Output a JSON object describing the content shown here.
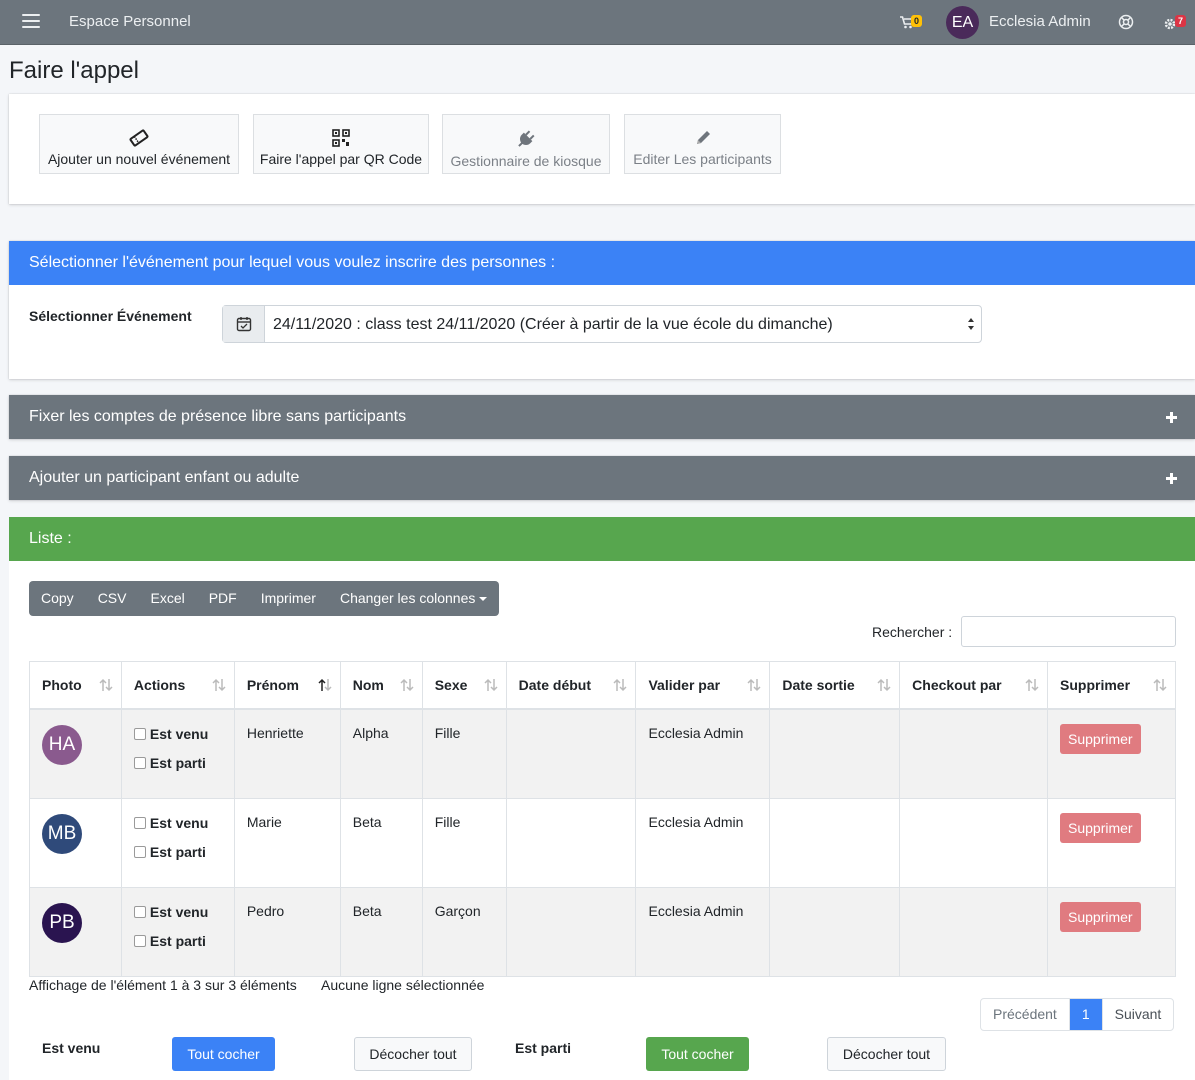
{
  "navbar": {
    "title": "Espace Personnel",
    "cart_count": "0",
    "avatar_initials": "EA",
    "user_name": "Ecclesia Admin",
    "notification_count": "7"
  },
  "page_title": "Faire l'appel",
  "toolbar": {
    "add_event": "Ajouter un nouvel événement",
    "qr_code": "Faire l'appel par QR Code",
    "kiosk": "Gestionnaire de kiosque",
    "edit_participants": "Editer Les participants"
  },
  "select_event": {
    "header": "Sélectionner l'événement pour lequel vous voulez inscrire des personnes :",
    "label": "Sélectionner Événement",
    "value": "24/11/2020 : class test 24/11/2020 (Créer à partir de la vue école du dimanche)"
  },
  "free_counts": {
    "header": "Fixer les comptes de présence libre sans participants"
  },
  "add_participant": {
    "header": "Ajouter un participant enfant ou adulte"
  },
  "list": {
    "header": "Liste :",
    "buttons": [
      "Copy",
      "CSV",
      "Excel",
      "PDF",
      "Imprimer",
      "Changer les colonnes"
    ],
    "search_label": "Rechercher :",
    "search_value": "",
    "columns": [
      "Photo",
      "Actions",
      "Prénom",
      "Nom",
      "Sexe",
      "Date début",
      "Valider par",
      "Date sortie",
      "Checkout par",
      "Supprimer"
    ],
    "check_in_label": "Est venu",
    "check_out_label": "Est parti",
    "delete_label": "Supprimer",
    "rows": [
      {
        "initials": "HA",
        "color": "#8a5a8e",
        "prenom": "Henriette",
        "nom": "Alpha",
        "sexe": "Fille",
        "date_debut": "",
        "valider_par": "Ecclesia Admin",
        "date_sortie": "",
        "checkout_par": ""
      },
      {
        "initials": "MB",
        "color": "#2f4a7a",
        "prenom": "Marie",
        "nom": "Beta",
        "sexe": "Fille",
        "date_debut": "",
        "valider_par": "Ecclesia Admin",
        "date_sortie": "",
        "checkout_par": ""
      },
      {
        "initials": "PB",
        "color": "#2a1450",
        "prenom": "Pedro",
        "nom": "Beta",
        "sexe": "Garçon",
        "date_debut": "",
        "valider_par": "Ecclesia Admin",
        "date_sortie": "",
        "checkout_par": ""
      }
    ],
    "info": "Affichage de l'élément 1 à 3 sur 3 éléments",
    "selection_info": "Aucune ligne sélectionnée",
    "pagination": {
      "previous": "Précédent",
      "current": "1",
      "next": "Suivant"
    }
  },
  "bulk": {
    "check_in_label": "Est venu",
    "check_out_label": "Est parti",
    "check_all": "Tout cocher",
    "uncheck_all": "Décocher tout"
  },
  "colors": {
    "navbar": "#6c757d",
    "primary": "#3b82f6",
    "success": "#57a64e",
    "danger_soft": "#e07b80"
  }
}
